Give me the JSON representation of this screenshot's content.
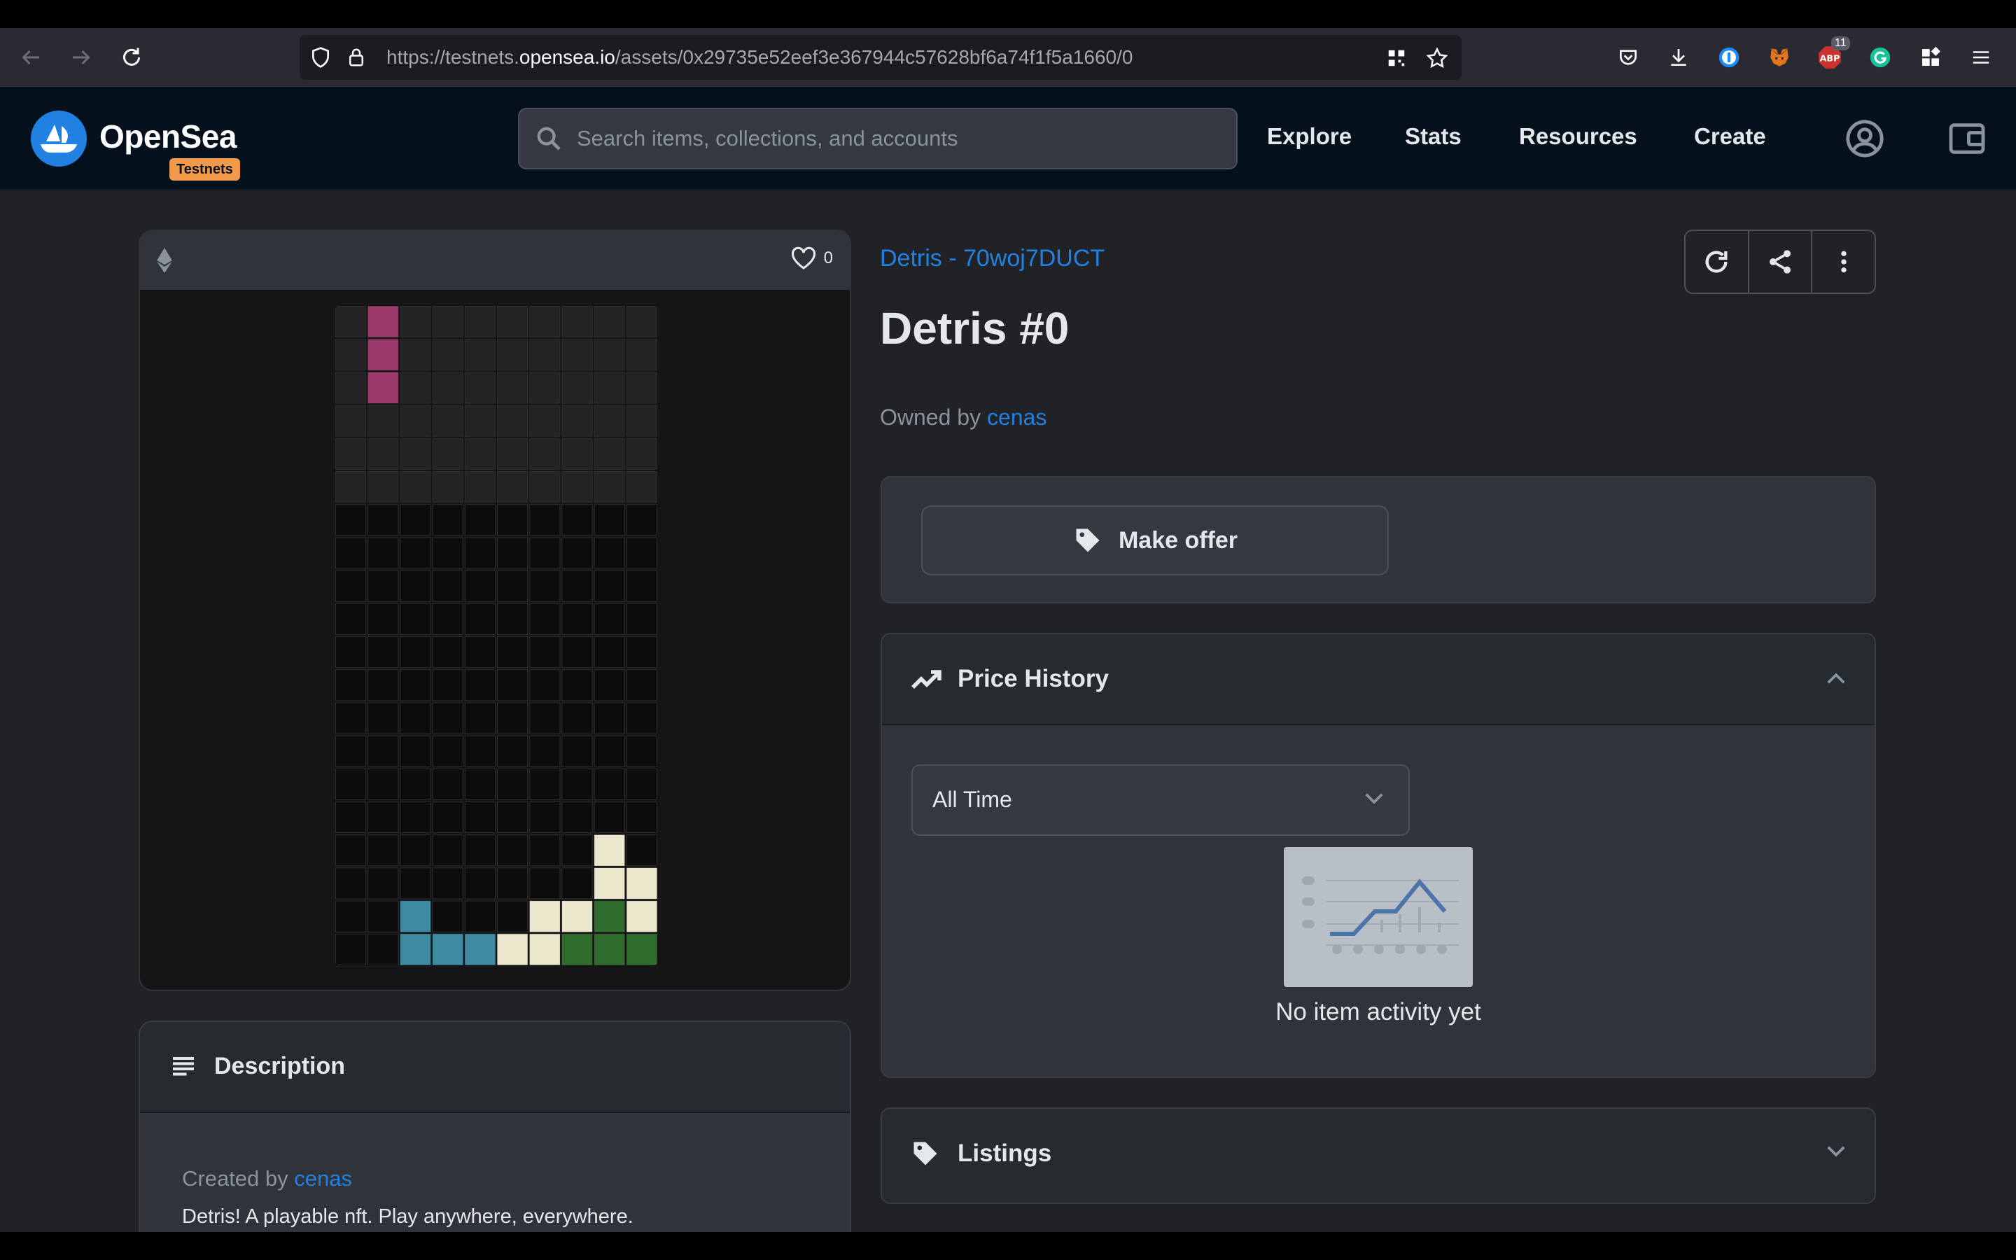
{
  "browser": {
    "url_prefix": "https://testnets.",
    "url_host": "opensea.io",
    "url_path": "/assets/0x29735e52eef3e367944c57628bf6a74f1f5a1660/0",
    "extension_badge": "11"
  },
  "header": {
    "logo_text": "OpenSea",
    "badge": "Testnets",
    "search_placeholder": "Search items, collections, and accounts",
    "nav": [
      "Explore",
      "Stats",
      "Resources",
      "Create"
    ]
  },
  "image_card": {
    "favorites_count": "0",
    "board": {
      "cols": 10,
      "rows": 20,
      "cells": [
        {
          "c": 1,
          "r": 0,
          "color": "#9b3a6b"
        },
        {
          "c": 1,
          "r": 1,
          "color": "#9b3a6b"
        },
        {
          "c": 1,
          "r": 2,
          "color": "#9b3a6b"
        },
        {
          "c": 8,
          "r": 16,
          "color": "#ebe7cc"
        },
        {
          "c": 8,
          "r": 17,
          "color": "#ebe7cc"
        },
        {
          "c": 9,
          "r": 17,
          "color": "#ebe7cc"
        },
        {
          "c": 2,
          "r": 18,
          "color": "#3f8aa3"
        },
        {
          "c": 6,
          "r": 18,
          "color": "#ebe7cc"
        },
        {
          "c": 7,
          "r": 18,
          "color": "#ebe7cc"
        },
        {
          "c": 8,
          "r": 18,
          "color": "#2f6d2c"
        },
        {
          "c": 9,
          "r": 18,
          "color": "#ebe7cc"
        },
        {
          "c": 2,
          "r": 19,
          "color": "#3f8aa3"
        },
        {
          "c": 3,
          "r": 19,
          "color": "#3f8aa3"
        },
        {
          "c": 4,
          "r": 19,
          "color": "#3f8aa3"
        },
        {
          "c": 5,
          "r": 19,
          "color": "#ebe7cc"
        },
        {
          "c": 6,
          "r": 19,
          "color": "#ebe7cc"
        },
        {
          "c": 7,
          "r": 19,
          "color": "#2f6d2c"
        },
        {
          "c": 8,
          "r": 19,
          "color": "#2f6d2c"
        },
        {
          "c": 9,
          "r": 19,
          "color": "#2f6d2c"
        }
      ]
    }
  },
  "description": {
    "title": "Description",
    "created_by_label": "Created by",
    "creator": "cenas",
    "text": "Detris! A playable nft. Play anywhere, everywhere."
  },
  "item": {
    "collection": "Detris - 70woj7DUCT",
    "title": "Detris #0",
    "owned_by_label": "Owned by",
    "owner": "cenas"
  },
  "offer": {
    "button_label": "Make offer"
  },
  "price_history": {
    "title": "Price History",
    "time_filter": "All Time",
    "empty_text": "No item activity yet"
  },
  "listings": {
    "title": "Listings"
  },
  "colors": {
    "accent": "#2081e2",
    "header_bg": "#04111d",
    "page_bg": "#202225",
    "card_bg": "#303339",
    "badge": "#f2994a"
  }
}
